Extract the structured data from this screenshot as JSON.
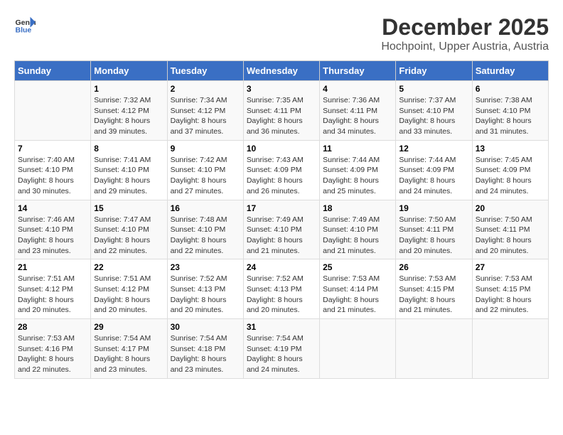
{
  "header": {
    "logo_general": "General",
    "logo_blue": "Blue",
    "title": "December 2025",
    "subtitle": "Hochpoint, Upper Austria, Austria"
  },
  "calendar": {
    "days_of_week": [
      "Sunday",
      "Monday",
      "Tuesday",
      "Wednesday",
      "Thursday",
      "Friday",
      "Saturday"
    ],
    "weeks": [
      [
        {
          "day": "",
          "info": ""
        },
        {
          "day": "1",
          "info": "Sunrise: 7:32 AM\nSunset: 4:12 PM\nDaylight: 8 hours\nand 39 minutes."
        },
        {
          "day": "2",
          "info": "Sunrise: 7:34 AM\nSunset: 4:12 PM\nDaylight: 8 hours\nand 37 minutes."
        },
        {
          "day": "3",
          "info": "Sunrise: 7:35 AM\nSunset: 4:11 PM\nDaylight: 8 hours\nand 36 minutes."
        },
        {
          "day": "4",
          "info": "Sunrise: 7:36 AM\nSunset: 4:11 PM\nDaylight: 8 hours\nand 34 minutes."
        },
        {
          "day": "5",
          "info": "Sunrise: 7:37 AM\nSunset: 4:10 PM\nDaylight: 8 hours\nand 33 minutes."
        },
        {
          "day": "6",
          "info": "Sunrise: 7:38 AM\nSunset: 4:10 PM\nDaylight: 8 hours\nand 31 minutes."
        }
      ],
      [
        {
          "day": "7",
          "info": "Sunrise: 7:40 AM\nSunset: 4:10 PM\nDaylight: 8 hours\nand 30 minutes."
        },
        {
          "day": "8",
          "info": "Sunrise: 7:41 AM\nSunset: 4:10 PM\nDaylight: 8 hours\nand 29 minutes."
        },
        {
          "day": "9",
          "info": "Sunrise: 7:42 AM\nSunset: 4:10 PM\nDaylight: 8 hours\nand 27 minutes."
        },
        {
          "day": "10",
          "info": "Sunrise: 7:43 AM\nSunset: 4:09 PM\nDaylight: 8 hours\nand 26 minutes."
        },
        {
          "day": "11",
          "info": "Sunrise: 7:44 AM\nSunset: 4:09 PM\nDaylight: 8 hours\nand 25 minutes."
        },
        {
          "day": "12",
          "info": "Sunrise: 7:44 AM\nSunset: 4:09 PM\nDaylight: 8 hours\nand 24 minutes."
        },
        {
          "day": "13",
          "info": "Sunrise: 7:45 AM\nSunset: 4:09 PM\nDaylight: 8 hours\nand 24 minutes."
        }
      ],
      [
        {
          "day": "14",
          "info": "Sunrise: 7:46 AM\nSunset: 4:10 PM\nDaylight: 8 hours\nand 23 minutes."
        },
        {
          "day": "15",
          "info": "Sunrise: 7:47 AM\nSunset: 4:10 PM\nDaylight: 8 hours\nand 22 minutes."
        },
        {
          "day": "16",
          "info": "Sunrise: 7:48 AM\nSunset: 4:10 PM\nDaylight: 8 hours\nand 22 minutes."
        },
        {
          "day": "17",
          "info": "Sunrise: 7:49 AM\nSunset: 4:10 PM\nDaylight: 8 hours\nand 21 minutes."
        },
        {
          "day": "18",
          "info": "Sunrise: 7:49 AM\nSunset: 4:10 PM\nDaylight: 8 hours\nand 21 minutes."
        },
        {
          "day": "19",
          "info": "Sunrise: 7:50 AM\nSunset: 4:11 PM\nDaylight: 8 hours\nand 20 minutes."
        },
        {
          "day": "20",
          "info": "Sunrise: 7:50 AM\nSunset: 4:11 PM\nDaylight: 8 hours\nand 20 minutes."
        }
      ],
      [
        {
          "day": "21",
          "info": "Sunrise: 7:51 AM\nSunset: 4:12 PM\nDaylight: 8 hours\nand 20 minutes."
        },
        {
          "day": "22",
          "info": "Sunrise: 7:51 AM\nSunset: 4:12 PM\nDaylight: 8 hours\nand 20 minutes."
        },
        {
          "day": "23",
          "info": "Sunrise: 7:52 AM\nSunset: 4:13 PM\nDaylight: 8 hours\nand 20 minutes."
        },
        {
          "day": "24",
          "info": "Sunrise: 7:52 AM\nSunset: 4:13 PM\nDaylight: 8 hours\nand 20 minutes."
        },
        {
          "day": "25",
          "info": "Sunrise: 7:53 AM\nSunset: 4:14 PM\nDaylight: 8 hours\nand 21 minutes."
        },
        {
          "day": "26",
          "info": "Sunrise: 7:53 AM\nSunset: 4:15 PM\nDaylight: 8 hours\nand 21 minutes."
        },
        {
          "day": "27",
          "info": "Sunrise: 7:53 AM\nSunset: 4:15 PM\nDaylight: 8 hours\nand 22 minutes."
        }
      ],
      [
        {
          "day": "28",
          "info": "Sunrise: 7:53 AM\nSunset: 4:16 PM\nDaylight: 8 hours\nand 22 minutes."
        },
        {
          "day": "29",
          "info": "Sunrise: 7:54 AM\nSunset: 4:17 PM\nDaylight: 8 hours\nand 23 minutes."
        },
        {
          "day": "30",
          "info": "Sunrise: 7:54 AM\nSunset: 4:18 PM\nDaylight: 8 hours\nand 23 minutes."
        },
        {
          "day": "31",
          "info": "Sunrise: 7:54 AM\nSunset: 4:19 PM\nDaylight: 8 hours\nand 24 minutes."
        },
        {
          "day": "",
          "info": ""
        },
        {
          "day": "",
          "info": ""
        },
        {
          "day": "",
          "info": ""
        }
      ]
    ]
  }
}
